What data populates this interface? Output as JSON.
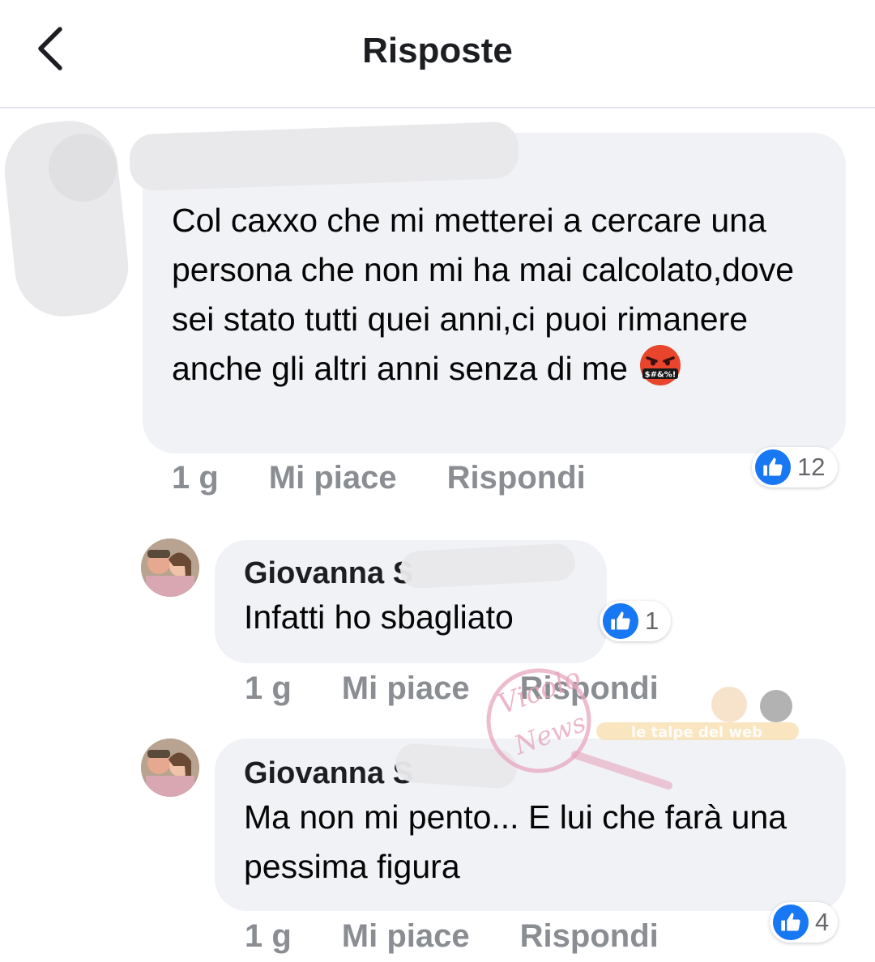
{
  "header": {
    "title": "Risposte",
    "back_icon": "chevron-left-icon"
  },
  "comments": [
    {
      "author": "",
      "text": "Col caxxo che mi metterei a cercare una persona che non mi ha mai calcolato,dove sei stato tutti quei anni,ci puoi rimanere anche gli altri anni senza di me",
      "emoji": "face-with-symbols-on-mouth",
      "time": "1 g",
      "like_label": "Mi piace",
      "reply_label": "Rispondi",
      "reaction_count": "12"
    },
    {
      "author": "Giovanna S",
      "text": "Infatti ho sbagliato",
      "time": "1 g",
      "like_label": "Mi piace",
      "reply_label": "Rispondi",
      "reaction_count": "1"
    },
    {
      "author": "Giovanna S",
      "text": "Ma non mi pento... E lui che farà una pessima figura",
      "time": "1 g",
      "like_label": "Mi piace",
      "reply_label": "Rispondi",
      "reaction_count": "4"
    }
  ],
  "watermark": {
    "logo_text": "Vicolo delle News",
    "banner_text": "le talpe del web"
  },
  "colors": {
    "like_blue": "#1877f2",
    "bubble_gray": "#f0f2f5",
    "meta_gray": "#8a8d91",
    "watermark_pink": "#e8a6bd"
  }
}
